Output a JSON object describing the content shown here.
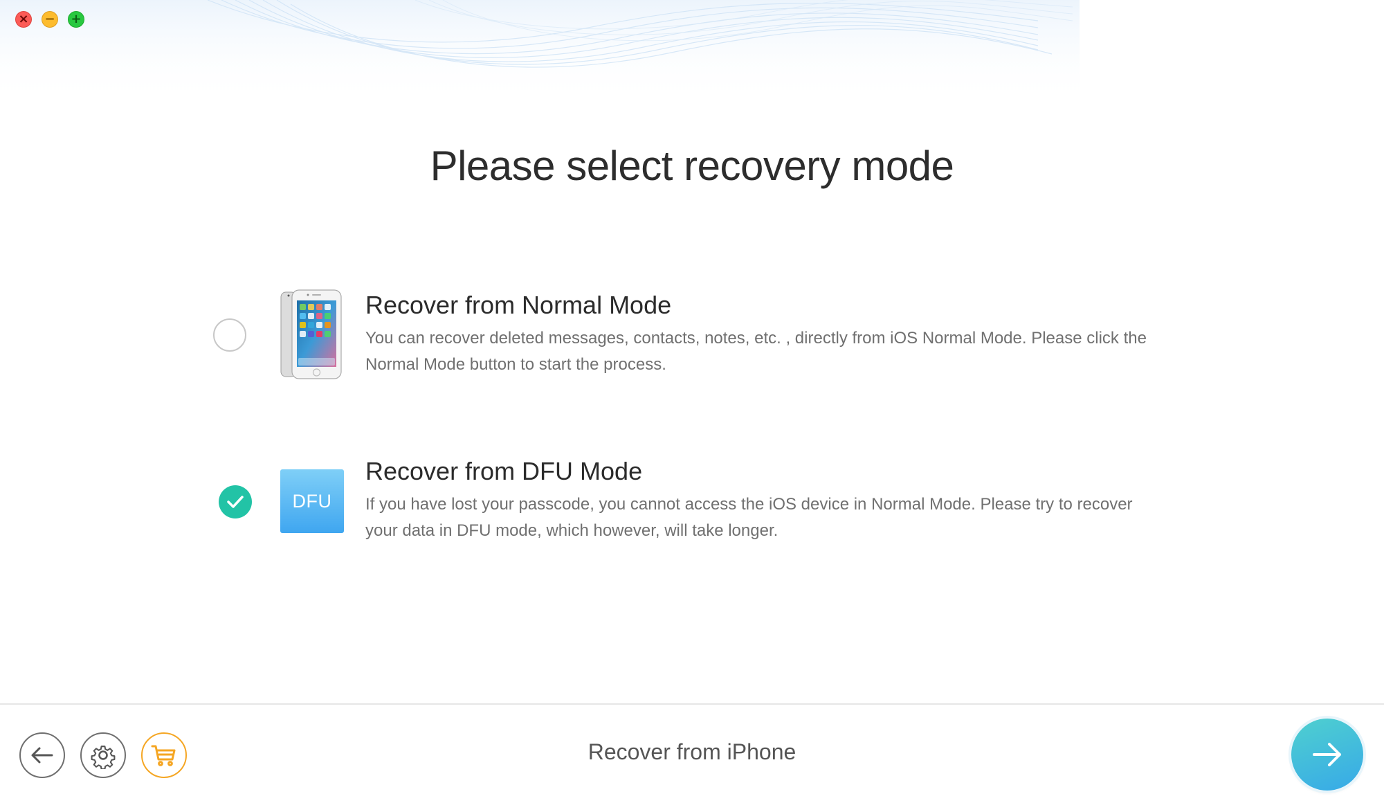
{
  "window": {
    "controls": {
      "close_glyph": "×",
      "minimize_glyph": "−",
      "maximize_glyph": "+"
    }
  },
  "main": {
    "title": "Please select recovery mode",
    "options": [
      {
        "title": "Recover from Normal Mode",
        "description": "You can recover deleted messages, contacts, notes, etc. , directly from iOS Normal Mode. Please click the Normal Mode button to start the process.",
        "selected": false,
        "icon": "iphone-icon"
      },
      {
        "title": "Recover from DFU Mode",
        "description": "If you have lost your passcode, you cannot access the iOS device in Normal Mode. Please try to recover your data in DFU mode, which however, will take longer.",
        "selected": true,
        "icon": "dfu-icon",
        "icon_label": "DFU"
      }
    ]
  },
  "footer": {
    "title": "Recover from iPhone",
    "buttons": {
      "back": "back-arrow-icon",
      "settings": "gear-icon",
      "store": "cart-icon",
      "next": "arrow-right-icon"
    }
  },
  "colors": {
    "accent_teal": "#22c3a6",
    "cart_orange": "#f5a623",
    "next_gradient_start": "#4fd0cf",
    "next_gradient_end": "#37a9e8"
  }
}
